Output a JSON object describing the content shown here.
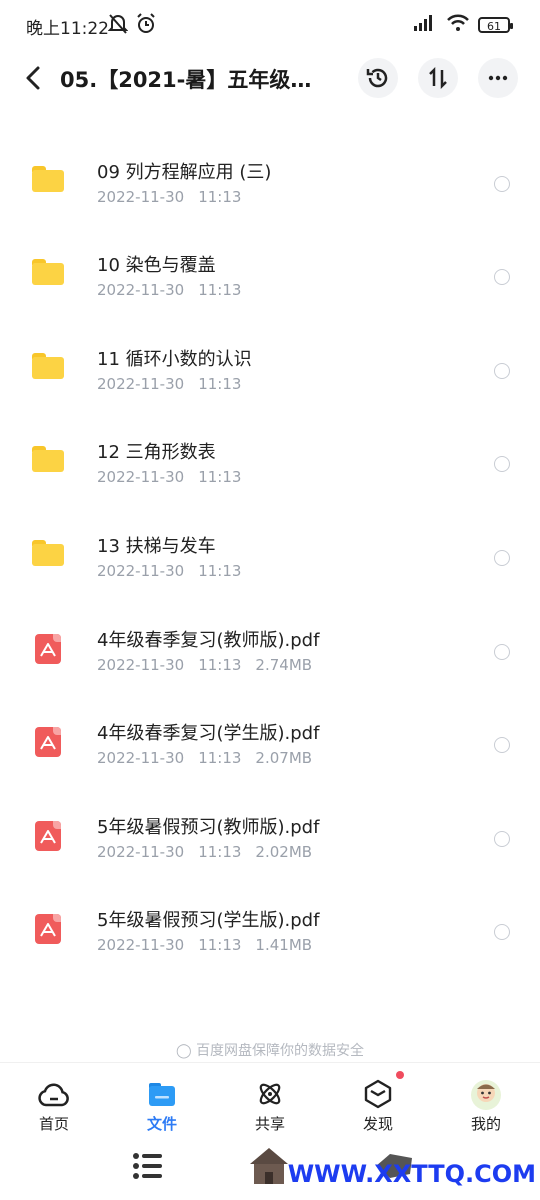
{
  "status_bar": {
    "time": "晚上11:22",
    "battery": "61"
  },
  "header": {
    "title": "05.【2021-暑】五年级数..."
  },
  "files": [
    {
      "name": "",
      "date": "2022-11-30",
      "time": "11:13",
      "size": "",
      "icon": "folder-icon"
    },
    {
      "name": "09 列方程解应用 (三)",
      "date": "2022-11-30",
      "time": "11:13",
      "size": "",
      "icon": "folder-icon"
    },
    {
      "name": "10 染色与覆盖",
      "date": "2022-11-30",
      "time": "11:13",
      "size": "",
      "icon": "folder-icon"
    },
    {
      "name": "11 循环小数的认识",
      "date": "2022-11-30",
      "time": "11:13",
      "size": "",
      "icon": "folder-icon"
    },
    {
      "name": "12 三角形数表",
      "date": "2022-11-30",
      "time": "11:13",
      "size": "",
      "icon": "folder-icon"
    },
    {
      "name": "13 扶梯与发车",
      "date": "2022-11-30",
      "time": "11:13",
      "size": "",
      "icon": "folder-icon"
    },
    {
      "name": "4年级春季复习(教师版).pdf",
      "date": "2022-11-30",
      "time": "11:13",
      "size": "2.74MB",
      "icon": "pdf-icon"
    },
    {
      "name": "4年级春季复习(学生版).pdf",
      "date": "2022-11-30",
      "time": "11:13",
      "size": "2.07MB",
      "icon": "pdf-icon"
    },
    {
      "name": "5年级暑假预习(教师版).pdf",
      "date": "2022-11-30",
      "time": "11:13",
      "size": "2.02MB",
      "icon": "pdf-icon"
    },
    {
      "name": "5年级暑假预习(学生版).pdf",
      "date": "2022-11-30",
      "time": "11:13",
      "size": "1.41MB",
      "icon": "pdf-icon"
    }
  ],
  "footer_note": "百度网盘保障你的数据安全",
  "tabs": [
    {
      "label": "首页",
      "icon": "home-cloud-icon"
    },
    {
      "label": "文件",
      "icon": "folder-icon"
    },
    {
      "label": "共享",
      "icon": "atom-icon"
    },
    {
      "label": "发现",
      "icon": "cube-icon"
    },
    {
      "label": "我的",
      "icon": "avatar"
    }
  ],
  "watermark": "WWW.XXTTQ.COM",
  "colors": {
    "accent": "#2d7bf5",
    "folder": "#fcd344",
    "pdf": "#f05b5b",
    "badge": "#f04c5e"
  }
}
